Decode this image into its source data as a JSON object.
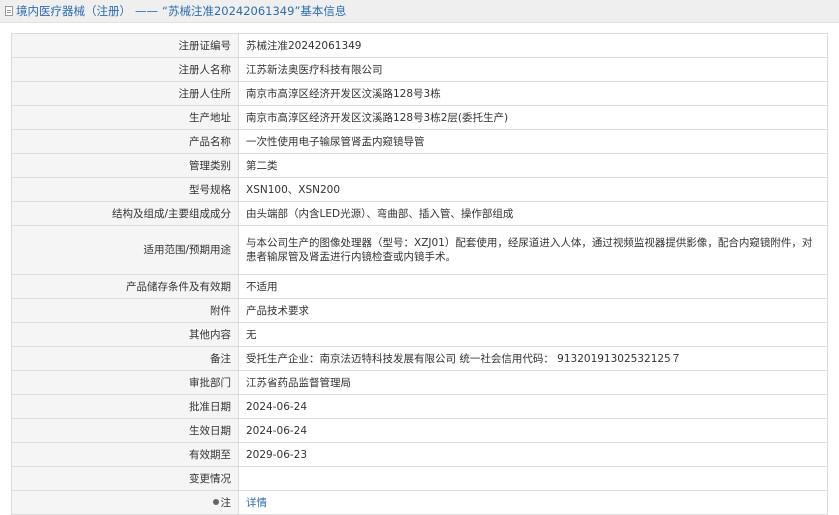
{
  "header": {
    "category": "境内医疗器械（注册）",
    "separator": "——",
    "title": "“苏械注准20242061349”基本信息"
  },
  "rows": [
    {
      "label": "注册证编号",
      "value": "苏械注准20242061349"
    },
    {
      "label": "注册人名称",
      "value": "江苏新法奥医疗科技有限公司"
    },
    {
      "label": "注册人住所",
      "value": "南京市高淳区经济开发区汶溪路128号3栋"
    },
    {
      "label": "生产地址",
      "value": "南京市高淳区经济开发区汶溪路128号3栋2层(委托生产)"
    },
    {
      "label": "产品名称",
      "value": "一次性使用电子输尿管肾盂内窥镜导管"
    },
    {
      "label": "管理类别",
      "value": "第二类"
    },
    {
      "label": "型号规格",
      "value": "XSN100、XSN200"
    },
    {
      "label": "结构及组成/主要组成成分",
      "value": "由头端部（内含LED光源）、弯曲部、插入管、操作部组成"
    },
    {
      "label": "适用范围/预期用途",
      "value": "与本公司生产的图像处理器（型号：XZJ01）配套使用，经尿道进入人体，通过视频监视器提供影像，配合内窥镜附件，对患者输尿管及肾盂进行内镜检查或内镜手术。"
    },
    {
      "label": "产品储存条件及有效期",
      "value": "不适用"
    },
    {
      "label": "附件",
      "value": "产品技术要求"
    },
    {
      "label": "其他内容",
      "value": "无"
    },
    {
      "label": "备注",
      "value": "受托生产企业：南京法迈特科技发展有限公司 统一社会信用代码： 91320191302532125７"
    },
    {
      "label": "审批部门",
      "value": "江苏省药品监督管理局"
    },
    {
      "label": "批准日期",
      "value": "2024-06-24"
    },
    {
      "label": "生效日期",
      "value": "2024-06-24"
    },
    {
      "label": "有效期至",
      "value": "2029-06-23"
    },
    {
      "label": "变更情况",
      "value": ""
    }
  ],
  "note": {
    "label": "注",
    "link": "详情",
    "icon": "info-bulb-icon"
  }
}
